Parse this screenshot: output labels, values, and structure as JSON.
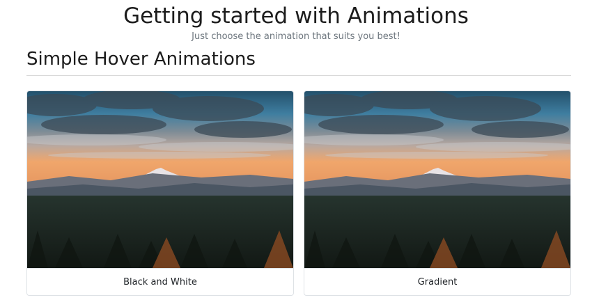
{
  "header": {
    "title": "Getting started with Animations",
    "subtitle": "Just choose the animation that suits you best!"
  },
  "section": {
    "title": "Simple Hover Animations"
  },
  "cards": [
    {
      "caption": "Black and White"
    },
    {
      "caption": "Gradient"
    }
  ],
  "colors": {
    "sky_top": "#1f5f80",
    "sunset": "#f2a56a",
    "forest": "#1a231c"
  }
}
